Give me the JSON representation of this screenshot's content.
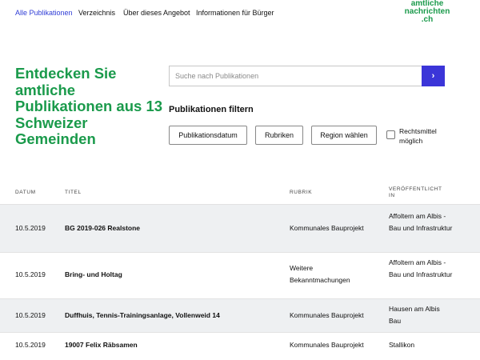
{
  "nav": {
    "items": [
      {
        "label": "Alle Publikationen",
        "active": true
      },
      {
        "label": "Verzeichnis",
        "active": false
      },
      {
        "label": "Über dieses Angebot",
        "active": false
      },
      {
        "label": "Informationen für Bürger",
        "active": false
      }
    ],
    "logo": [
      "amtliche",
      "nachrichten",
      ".ch"
    ]
  },
  "hero": {
    "title": "Entdecken Sie amtliche Publikationen aus 13 Schweizer Gemeinden"
  },
  "search": {
    "placeholder": "Suche nach Publikationen",
    "button_icon": "chevron-right-icon"
  },
  "filters": {
    "heading": "Publikationen filtern",
    "buttons": [
      "Publikationsdatum",
      "Rubriken",
      "Region wählen"
    ],
    "checkbox_label": "Rechtsmittel möglich",
    "checkbox_checked": false
  },
  "table": {
    "headers": [
      "DATUM",
      "TITEL",
      "RUBRIK",
      "VERÖFFENTLICHT IN"
    ],
    "rows": [
      {
        "date": "10.5.2019",
        "title": "BG 2019-026 Realstone",
        "rubrik": "Kommunales Bauprojekt",
        "published_in": "Affoltern am Albis - Bau und Infrastruktur"
      },
      {
        "date": "10.5.2019",
        "title": "Bring- und Holtag",
        "rubrik": "Weitere Bekanntmachungen",
        "published_in": "Affoltern am Albis - Bau und Infrastruktur"
      },
      {
        "date": "10.5.2019",
        "title": "Duffhuis, Tennis-Trainingsanlage, Vollenweid 14",
        "rubrik": "Kommunales Bauprojekt",
        "published_in": "Hausen am Albis Bau"
      },
      {
        "date": "10.5.2019",
        "title": "19007 Felix Räbsamen",
        "rubrik": "Kommunales Bauprojekt",
        "published_in": "Stallikon"
      }
    ]
  },
  "colors": {
    "accent_green": "#1a9a4b",
    "accent_blue": "#3b35d8",
    "active_link": "#2f3dd6",
    "row_shade": "#eef0f2"
  }
}
